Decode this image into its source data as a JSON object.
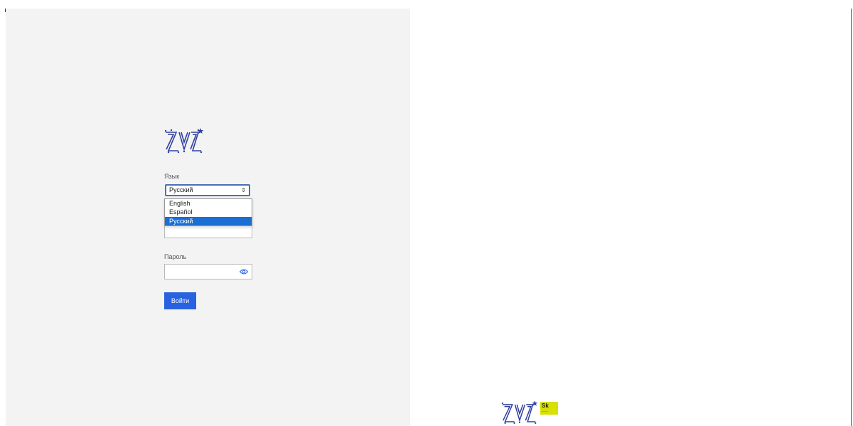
{
  "form": {
    "language_label": "Язык",
    "language_selected": "Русский",
    "language_options": [
      "English",
      "Español",
      "Русский"
    ],
    "password_label": "Пароль",
    "submit_label": "Войти"
  },
  "footer": {
    "badge_text": "Sk"
  },
  "colors": {
    "panel_bg": "#f3f3f4",
    "accent": "#2962e0",
    "option_highlight": "#1a6fd4",
    "logo_blue": "#2e3f9e",
    "badge_yellow": "#d8e000"
  },
  "icons": [
    "logo-icon",
    "chevron-updown-icon",
    "eye-icon",
    "partner-badge-icon"
  ]
}
